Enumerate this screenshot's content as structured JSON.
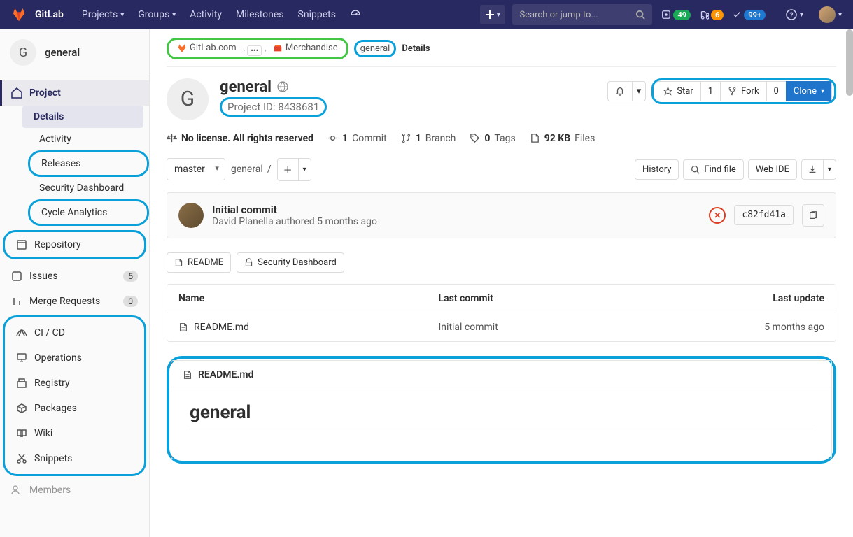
{
  "nav": {
    "brand": "GitLab",
    "projects": "Projects",
    "groups": "Groups",
    "activity": "Activity",
    "milestones": "Milestones",
    "snippets": "Snippets",
    "search_placeholder": "Search or jump to...",
    "issues_cnt": "49",
    "mrs_cnt": "6",
    "todos_cnt": "99+"
  },
  "sidebar": {
    "project_short": "G",
    "project_name": "general",
    "items": {
      "project": "Project",
      "details": "Details",
      "activity": "Activity",
      "releases": "Releases",
      "security_dashboard": "Security Dashboard",
      "cycle_analytics": "Cycle Analytics",
      "repository": "Repository",
      "issues": "Issues",
      "issues_cnt": "5",
      "merge_requests": "Merge Requests",
      "mr_cnt": "0",
      "cicd": "CI / CD",
      "operations": "Operations",
      "registry": "Registry",
      "packages": "Packages",
      "wiki": "Wiki",
      "snippets": "Snippets",
      "members": "Members"
    }
  },
  "crumbs": {
    "gitlab": "GitLab.com",
    "group": "Merchandise",
    "project": "general",
    "page": "Details"
  },
  "project": {
    "avatar": "G",
    "name": "general",
    "id_label": "Project ID: 8438681"
  },
  "actions": {
    "star": "Star",
    "star_cnt": "1",
    "fork": "Fork",
    "fork_cnt": "0",
    "clone": "Clone"
  },
  "stats": {
    "license": "No license. All rights reserved",
    "commits_n": "1",
    "commits": "Commit",
    "branches_n": "1",
    "branches": "Branch",
    "tags_n": "0",
    "tags": "Tags",
    "size_n": "92 KB",
    "size": "Files"
  },
  "branch": {
    "ref": "master",
    "path": "general",
    "sep": "/",
    "history": "History",
    "find": "Find file",
    "ide": "Web IDE"
  },
  "commit": {
    "msg": "Initial commit",
    "meta": "David Planella authored 5 months ago",
    "sha": "c82fd41a"
  },
  "pills": {
    "readme": "README",
    "security": "Security Dashboard"
  },
  "table": {
    "col_name": "Name",
    "col_commit": "Last commit",
    "col_update": "Last update",
    "rows": [
      {
        "name": "README.md",
        "commit": "Initial commit",
        "update": "5 months ago"
      }
    ]
  },
  "readme": {
    "filename": "README.md",
    "heading": "general"
  }
}
